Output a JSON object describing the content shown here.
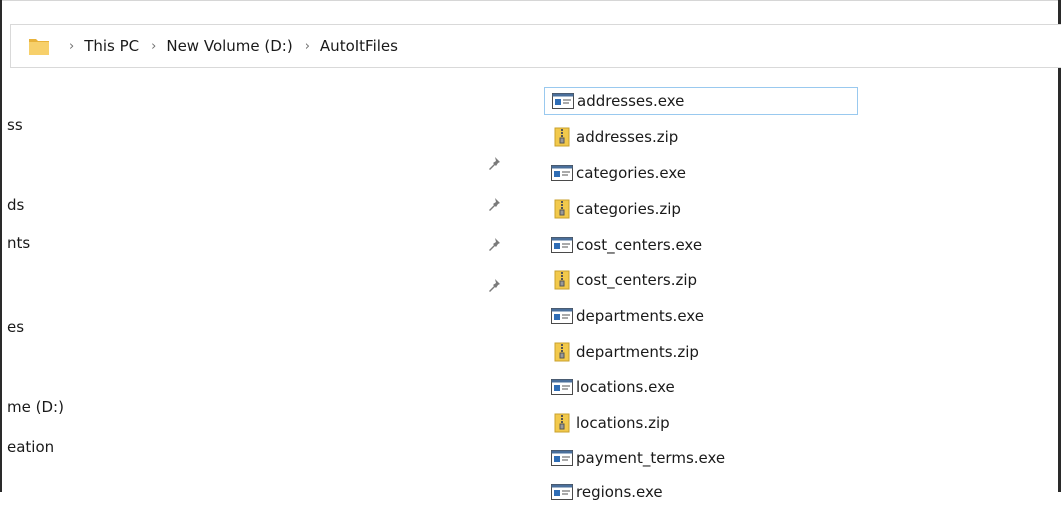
{
  "breadcrumb": {
    "items": [
      "This PC",
      "New Volume (D:)",
      "AutoItFiles"
    ]
  },
  "nav_pane": {
    "items": [
      "ss",
      "ds",
      "nts",
      "es",
      "me (D:)",
      "eation"
    ]
  },
  "files": [
    {
      "name": "addresses.exe",
      "type": "exe",
      "selected": true
    },
    {
      "name": "addresses.zip",
      "type": "zip"
    },
    {
      "name": "categories.exe",
      "type": "exe"
    },
    {
      "name": "categories.zip",
      "type": "zip"
    },
    {
      "name": "cost_centers.exe",
      "type": "exe"
    },
    {
      "name": "cost_centers.zip",
      "type": "zip"
    },
    {
      "name": "departments.exe",
      "type": "exe"
    },
    {
      "name": "departments.zip",
      "type": "zip"
    },
    {
      "name": "locations.exe",
      "type": "exe"
    },
    {
      "name": "locations.zip",
      "type": "zip"
    },
    {
      "name": "payment_terms.exe",
      "type": "exe"
    },
    {
      "name": "regions.exe",
      "type": "exe"
    }
  ],
  "colors": {
    "selection_border": "#99c9ef",
    "folder_yellow": "#f5c542",
    "zip_yellow": "#f2c94c"
  }
}
